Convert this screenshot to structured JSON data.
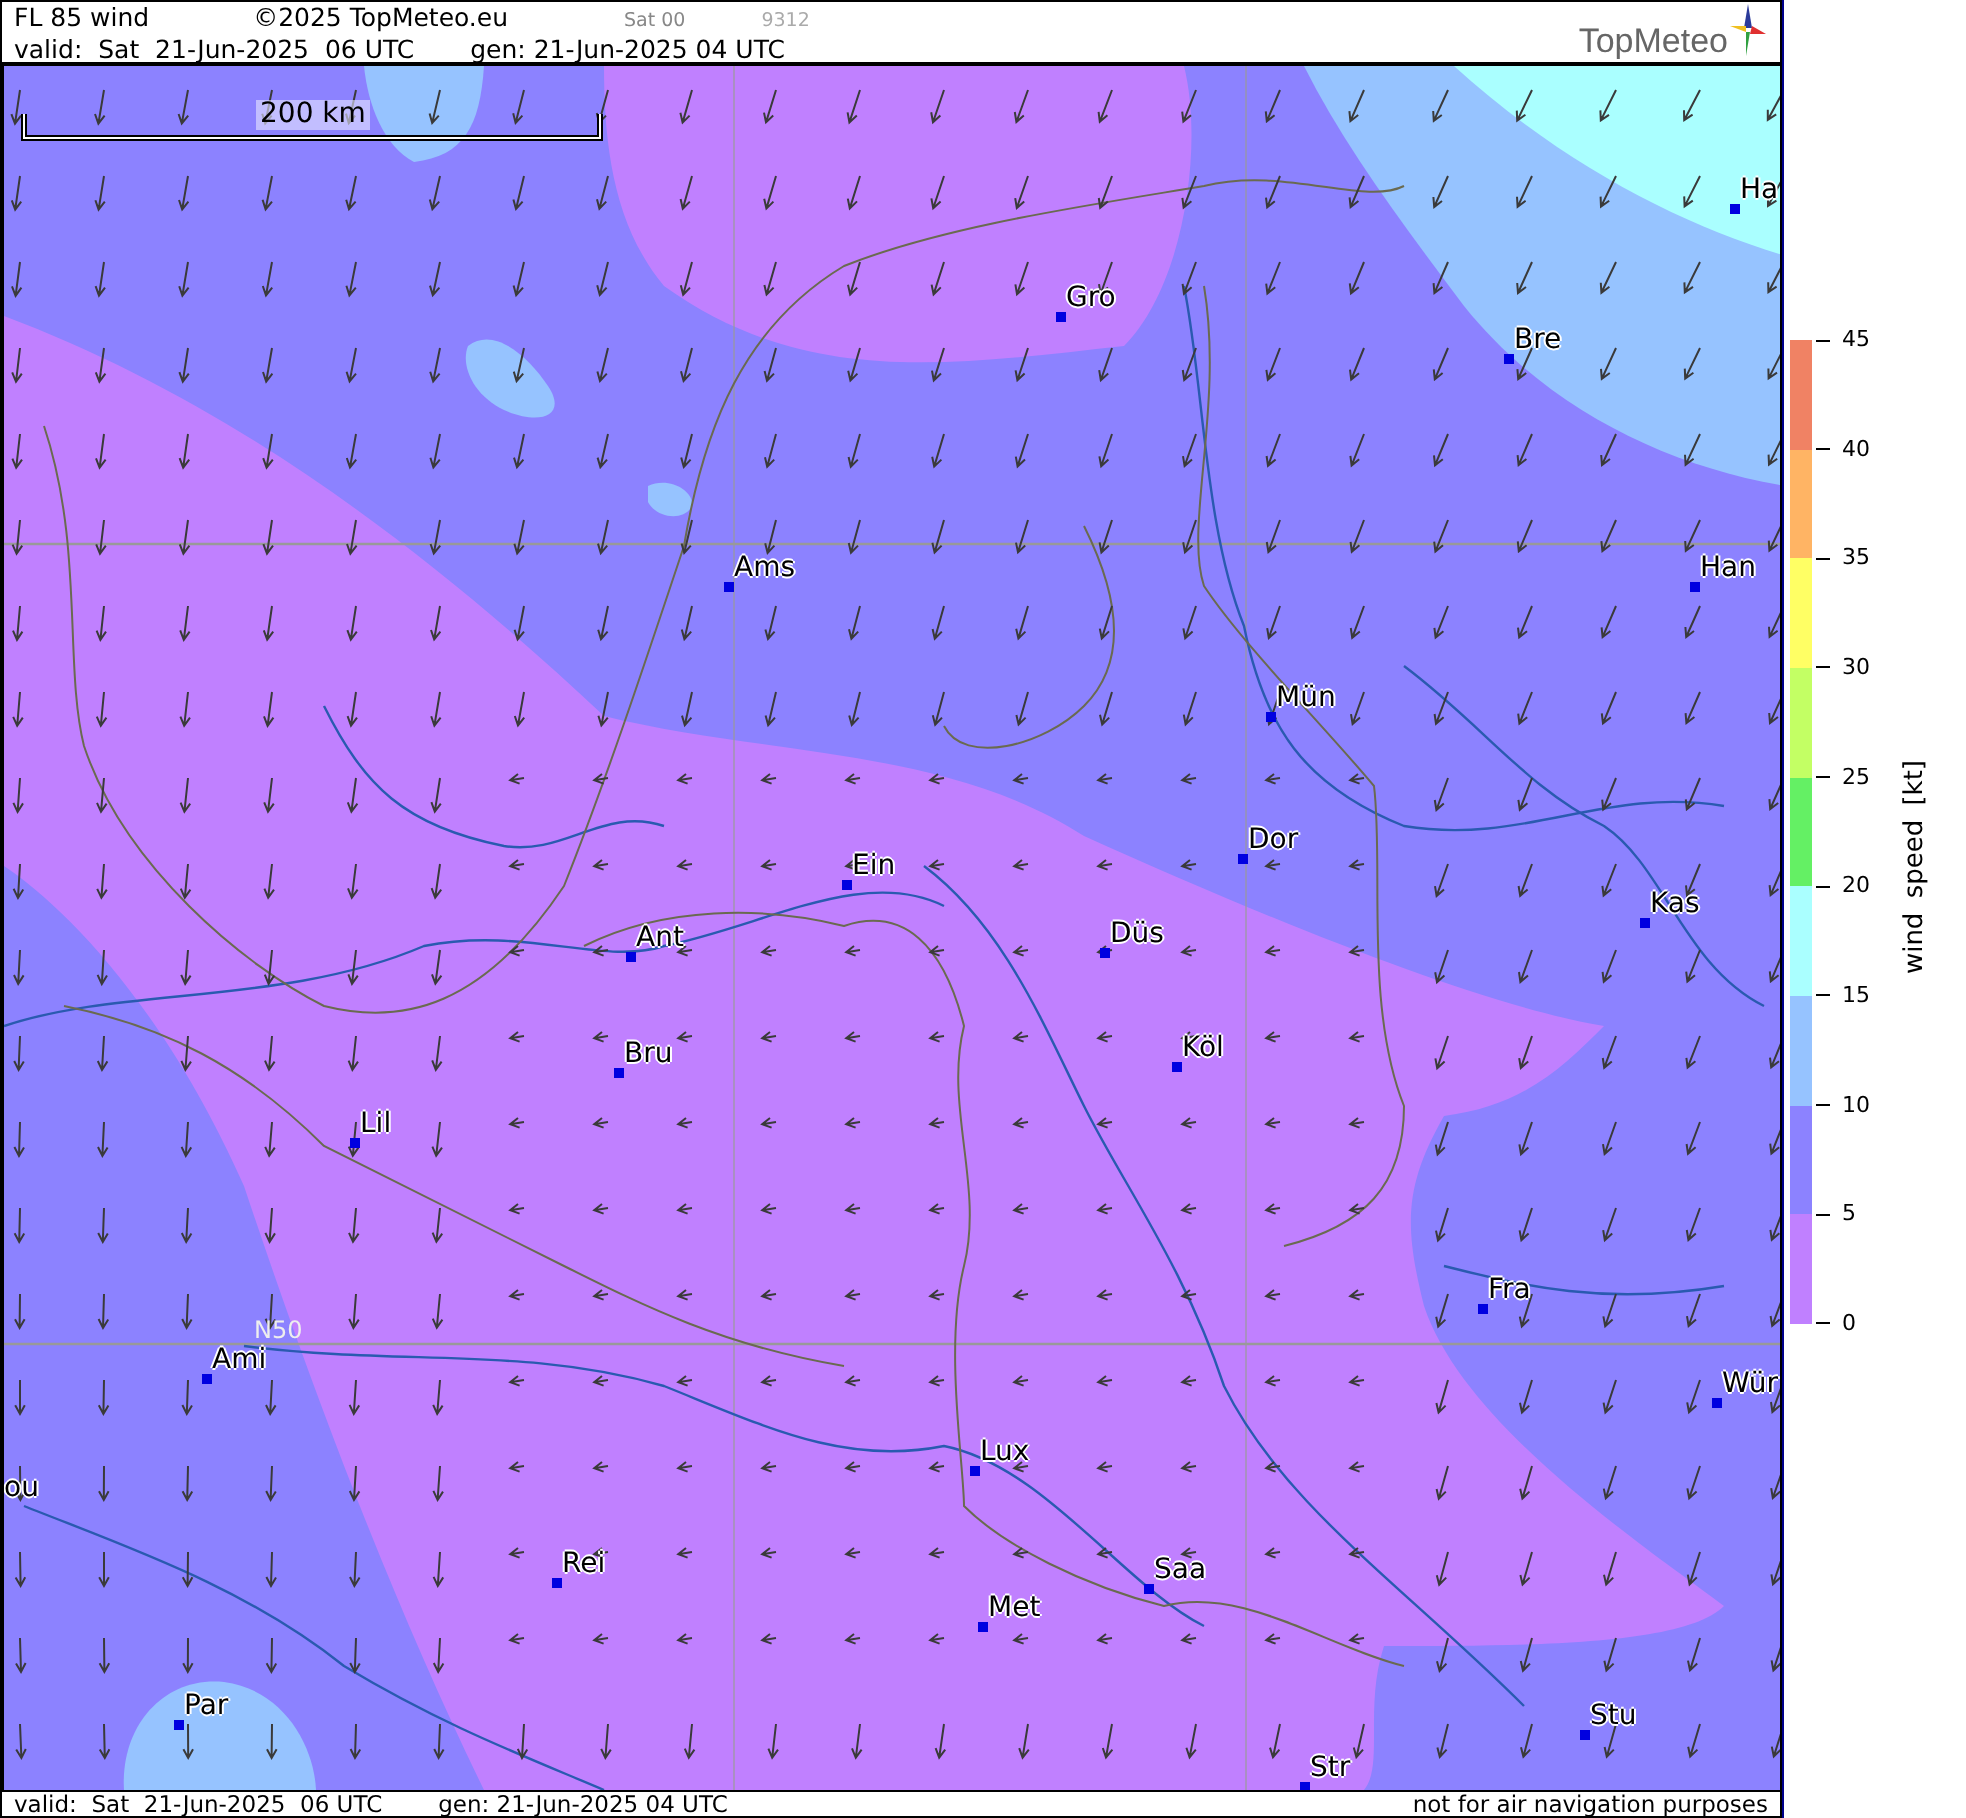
{
  "header": {
    "title": "FL 85 wind",
    "copyright": "©2025 TopMeteo.eu",
    "run": "Sat 00",
    "code": "9312",
    "valid": "valid:  Sat  21-Jun-2025  06 UTC",
    "generated": "gen: 21-Jun-2025 04 UTC",
    "logo": "TopMeteo"
  },
  "map": {
    "scale": "200 km",
    "latitude_label": "N50",
    "cities": [
      {
        "name": "Ha"
      },
      {
        "name": "Gro"
      },
      {
        "name": "Bre"
      },
      {
        "name": "Ams"
      },
      {
        "name": "Han"
      },
      {
        "name": "Mün"
      },
      {
        "name": "Dor"
      },
      {
        "name": "Ein"
      },
      {
        "name": "Kas"
      },
      {
        "name": "Ant"
      },
      {
        "name": "Düs"
      },
      {
        "name": "Köl"
      },
      {
        "name": "Bru"
      },
      {
        "name": "Lil"
      },
      {
        "name": "Fra"
      },
      {
        "name": "Ami"
      },
      {
        "name": "Wür"
      },
      {
        "name": "Lux"
      },
      {
        "name": "Rei"
      },
      {
        "name": "Saa"
      },
      {
        "name": "Met"
      },
      {
        "name": "Par"
      },
      {
        "name": "Stu"
      },
      {
        "name": "Str"
      },
      {
        "name": "ou"
      }
    ]
  },
  "legend": {
    "title": "wind speed [kt]",
    "ticks": [
      "45",
      "40",
      "35",
      "30",
      "25",
      "20",
      "15",
      "10",
      "5",
      "0"
    ],
    "bands": [
      {
        "color": "#f08264"
      },
      {
        "color": "#ffb464"
      },
      {
        "color": "#ffff64"
      },
      {
        "color": "#c3ff64"
      },
      {
        "color": "#64f064"
      },
      {
        "color": "#aaffff"
      },
      {
        "color": "#96c3ff"
      },
      {
        "color": "#8c82ff"
      },
      {
        "color": "#c080ff"
      }
    ]
  },
  "footer": {
    "valid": "valid:  Sat  21-Jun-2025  06 UTC",
    "generated": "gen: 21-Jun-2025 04 UTC",
    "notice": "not for air navigation purposes"
  }
}
